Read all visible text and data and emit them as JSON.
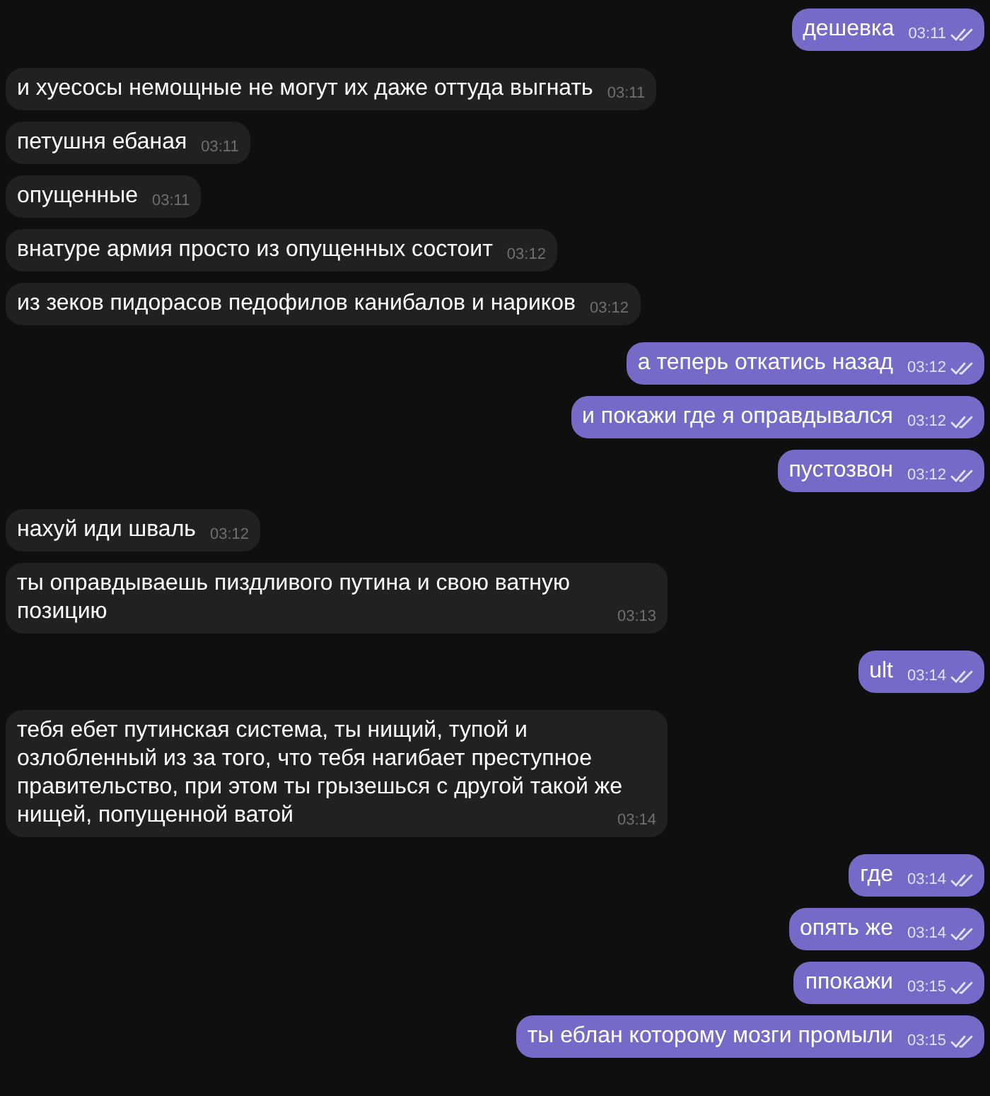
{
  "messages": [
    {
      "kind": "out",
      "text": "дешевка",
      "time": "03:11",
      "read": true
    },
    {
      "kind": "in",
      "text": "и хуесосы немощные не могут их даже оттуда выгнать",
      "time": "03:11"
    },
    {
      "kind": "in",
      "text": "петушня ебаная",
      "time": "03:11"
    },
    {
      "kind": "in",
      "text": "опущенные",
      "time": "03:11"
    },
    {
      "kind": "in",
      "text": "внатуре армия просто из опущенных состоит",
      "time": "03:12"
    },
    {
      "kind": "in",
      "text": "из зеков пидорасов педофилов канибалов и нариков",
      "time": "03:12"
    },
    {
      "kind": "out",
      "text": "а теперь откатись назад",
      "time": "03:12",
      "read": true
    },
    {
      "kind": "out",
      "text": "и покажи где я оправдывался",
      "time": "03:12",
      "read": true
    },
    {
      "kind": "out",
      "text": "пустозвон",
      "time": "03:12",
      "read": true
    },
    {
      "kind": "in",
      "text": "нахуй иди шваль",
      "time": "03:12"
    },
    {
      "kind": "in",
      "text": "ты оправдываешь пиздливого путина и свою ватную позицию",
      "time": "03:13"
    },
    {
      "kind": "out",
      "text": "ult",
      "time": "03:14",
      "read": true
    },
    {
      "kind": "in",
      "text": "тебя ебет путинская система, ты нищий, тупой и озлобленный из за того, что тебя нагибает преступное правительство, при этом ты грызешься с другой такой же нищей, попущенной ватой",
      "time": "03:14"
    },
    {
      "kind": "out",
      "text": "где",
      "time": "03:14",
      "read": true
    },
    {
      "kind": "out",
      "text": "опять же",
      "time": "03:14",
      "read": true
    },
    {
      "kind": "out",
      "text": "ппокажи",
      "time": "03:15",
      "read": true
    },
    {
      "kind": "out",
      "text": "ты еблан которому мозги промыли",
      "time": "03:15",
      "read": true
    }
  ]
}
